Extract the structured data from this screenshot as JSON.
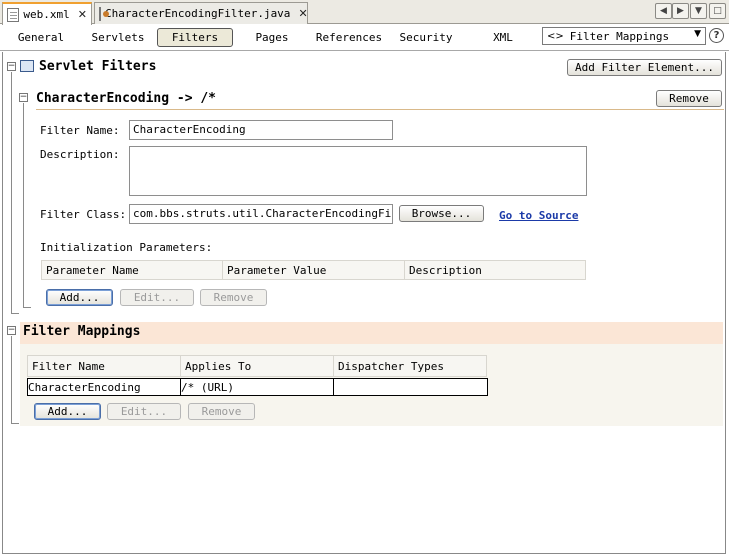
{
  "tabs": [
    {
      "label": "web.xml",
      "active": true
    },
    {
      "label": "CharacterEncodingFilter.java",
      "active": false
    }
  ],
  "window_controls": [
    "scroll-left-icon",
    "scroll-right-icon",
    "show-opened-documents-icon",
    "maximize-icon"
  ],
  "nav": {
    "tabs": [
      {
        "label": "General",
        "selected": false
      },
      {
        "label": "Servlets",
        "selected": false
      },
      {
        "label": "Filters",
        "selected": true
      },
      {
        "label": "Pages",
        "selected": false
      },
      {
        "label": "References",
        "selected": false
      },
      {
        "label": "Security",
        "selected": false
      },
      {
        "label": "XML",
        "selected": false
      }
    ],
    "view_select": "Filter Mappings",
    "help": "?"
  },
  "servlet_filters": {
    "title": "Servlet Filters",
    "add_button": "Add Filter Element..."
  },
  "filter": {
    "heading": "CharacterEncoding -> /*",
    "remove_button": "Remove",
    "name_label": "Filter Name:",
    "name_value": "CharacterEncoding",
    "description_label": "Description:",
    "description_value": "",
    "class_label": "Filter Class:",
    "class_value": "com.bbs.struts.util.CharacterEncodingFilter",
    "browse_button": "Browse...",
    "go_to_source": "Go to Source",
    "init_params_label": "Initialization Parameters:",
    "params_columns": [
      "Parameter Name",
      "Parameter Value",
      "Description"
    ],
    "params_buttons": {
      "add": "Add...",
      "edit": "Edit...",
      "remove": "Remove"
    }
  },
  "filter_mappings": {
    "title": "Filter Mappings",
    "columns": [
      "Filter Name",
      "Applies To",
      "Dispatcher Types"
    ],
    "rows": [
      {
        "filter_name": "CharacterEncoding",
        "applies_to": "/* (URL)",
        "dispatcher_types": ""
      }
    ],
    "buttons": {
      "add": "Add...",
      "edit": "Edit...",
      "remove": "Remove"
    }
  },
  "colors": {
    "active_tab_accent": "#f0a030",
    "mapping_header_bg": "#fbe6d6",
    "link": "#1b3aa8"
  }
}
